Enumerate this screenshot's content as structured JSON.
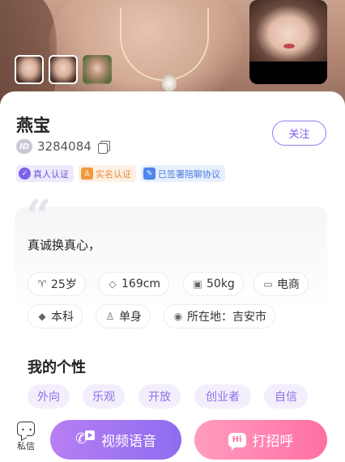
{
  "profile": {
    "name": "燕宝",
    "id_label": "ID",
    "id_number": "3284084",
    "follow_label": "关注",
    "badges": [
      {
        "label": "真人认证",
        "icon": "verified-person-icon",
        "color": "#7b62e6"
      },
      {
        "label": "实名认证",
        "icon": "id-card-icon",
        "color": "#f19a3e"
      },
      {
        "label": "已签署陪聊协议",
        "icon": "agreement-icon",
        "color": "#4f85ec"
      }
    ]
  },
  "intro": {
    "quote_mark": "“",
    "text": "真诚换真心，"
  },
  "info_chips": [
    {
      "icon": "age-icon",
      "glyph": "♈",
      "label": "25岁"
    },
    {
      "icon": "ruler-icon",
      "glyph": "◇",
      "label": "169cm"
    },
    {
      "icon": "scale-icon",
      "glyph": "▣",
      "label": "50kg"
    },
    {
      "icon": "job-icon",
      "glyph": "▭",
      "label": "电商"
    },
    {
      "icon": "education-icon",
      "glyph": "◆",
      "label": "本科"
    },
    {
      "icon": "person-icon",
      "glyph": "♙",
      "label": "单身"
    },
    {
      "icon": "location-icon",
      "glyph": "◉",
      "label": "所在地：吉安市"
    }
  ],
  "personality": {
    "title": "我的个性",
    "traits": [
      "外向",
      "乐观",
      "开放",
      "创业者",
      "自信"
    ]
  },
  "bottom_bar": {
    "dm_label": "私信",
    "video_label": "视频语音",
    "greet_label": "打招呼",
    "greet_icon_text": "Hi"
  },
  "colors": {
    "accent_purple": "#8e6cf0",
    "accent_pink": "#ff6fa4"
  }
}
